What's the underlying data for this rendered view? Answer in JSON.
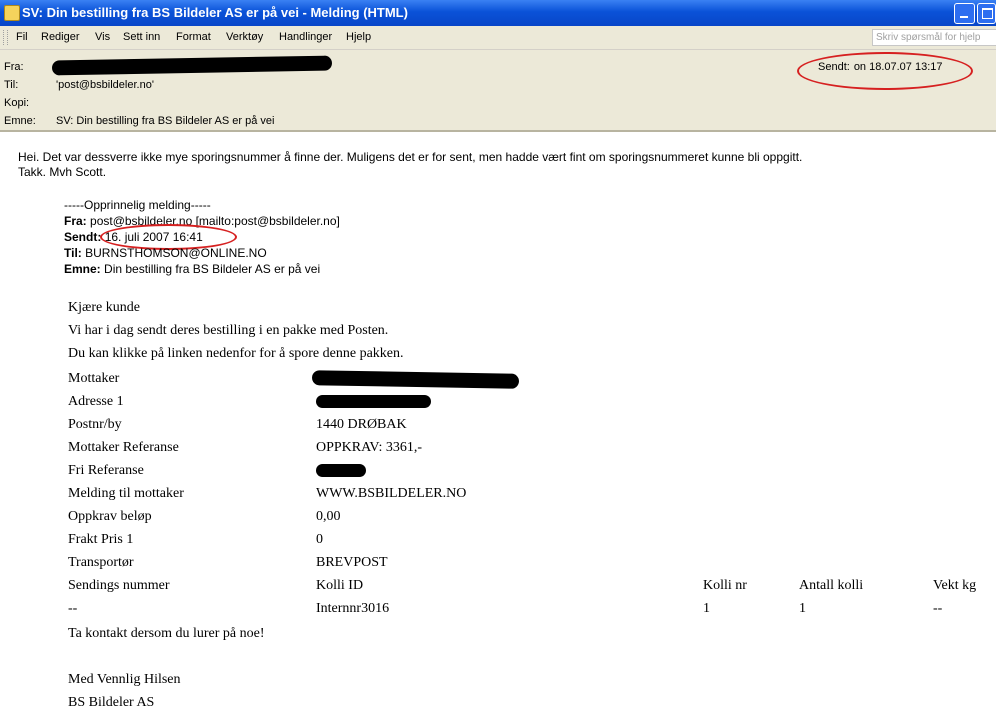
{
  "window": {
    "title": "SV: Din bestilling fra BS Bildeler AS er på vei - Melding (HTML)"
  },
  "menu": [
    "Fil",
    "Rediger",
    "Vis",
    "Sett inn",
    "Format",
    "Verktøy",
    "Handlinger",
    "Hjelp"
  ],
  "help_search": {
    "placeholder": "Skriv spørsmål for hjelp"
  },
  "header": {
    "from_label": "Fra:",
    "to_label": "Til:",
    "to_value": "'post@bsbildeler.no'",
    "cc_label": "Kopi:",
    "subject_label": "Emne:",
    "subject_value": "SV: Din bestilling fra BS Bildeler AS er på vei",
    "sent_label": "Sendt:",
    "sent_value": "on 18.07.07 13:17"
  },
  "reply": {
    "line1": "Hei. Det var dessverre ikke mye sporingsnummer å finne der. Muligens det er for sent, men hadde vært fint om sporingsnummeret kunne bli oppgitt.",
    "line2": "Takk. Mvh Scott."
  },
  "original": {
    "separator": "-----Opprinnelig melding-----",
    "from_label": "Fra:",
    "from_value": "post@bsbildeler.no [mailto:post@bsbildeler.no]",
    "sent_label": "Sendt:",
    "sent_value": "16. juli 2007 16:41",
    "to_label": "Til:",
    "to_value": "BURNSTHOMSON@ONLINE.NO",
    "subject_label": "Emne:",
    "subject_value": "Din bestilling fra BS Bildeler AS er på vei"
  },
  "notice": {
    "greeting": "Kjære kunde",
    "intro1": "Vi har i dag sendt deres bestilling i en pakke med Posten.",
    "intro2": "Du kan klikke på linken nedenfor for å spore denne pakken.",
    "fields": [
      {
        "label": "Mottaker",
        "value": ""
      },
      {
        "label": "Adresse 1",
        "value": ""
      },
      {
        "label": "Postnr/by",
        "value": "1440 DRØBAK"
      },
      {
        "label": "Mottaker Referanse",
        "value": "OPPKRAV: 3361,-"
      },
      {
        "label": "Fri Referanse",
        "value": ""
      },
      {
        "label": "Melding til mottaker",
        "value": "WWW.BSBILDELER.NO"
      },
      {
        "label": "Oppkrav beløp",
        "value": "0,00"
      },
      {
        "label": "Frakt Pris 1",
        "value": "0"
      },
      {
        "label": "Transportør",
        "value": "BREVPOST"
      }
    ],
    "table_headers": [
      "Sendings nummer",
      "Kolli ID",
      "Kolli nr",
      "Antall kolli",
      "Vekt kg"
    ],
    "table_row": [
      "--",
      "Internnr3016",
      "1",
      "1",
      "--"
    ],
    "contact": "Ta kontakt dersom du lurer på noe!",
    "closing": "Med Vennlig Hilsen",
    "signature": "BS Bildeler AS"
  },
  "colors": {
    "title_bar": "#0a52d8",
    "chrome": "#ece9d8",
    "annotation": "#d62020"
  }
}
